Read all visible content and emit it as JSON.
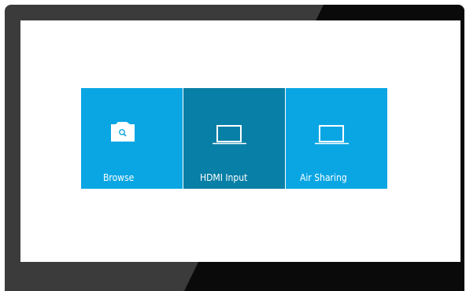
{
  "colors": {
    "tile": "#0aa6e4",
    "tile_active": "#087fa6",
    "bezel": "#3b3b3b",
    "screen": "#ffffff"
  },
  "tiles": [
    {
      "label": "Browse",
      "icon": "folder-search-icon",
      "selected": false
    },
    {
      "label": "HDMI Input",
      "icon": "laptop-icon",
      "selected": true
    },
    {
      "label": "Air Sharing",
      "icon": "laptop-icon",
      "selected": false
    }
  ]
}
